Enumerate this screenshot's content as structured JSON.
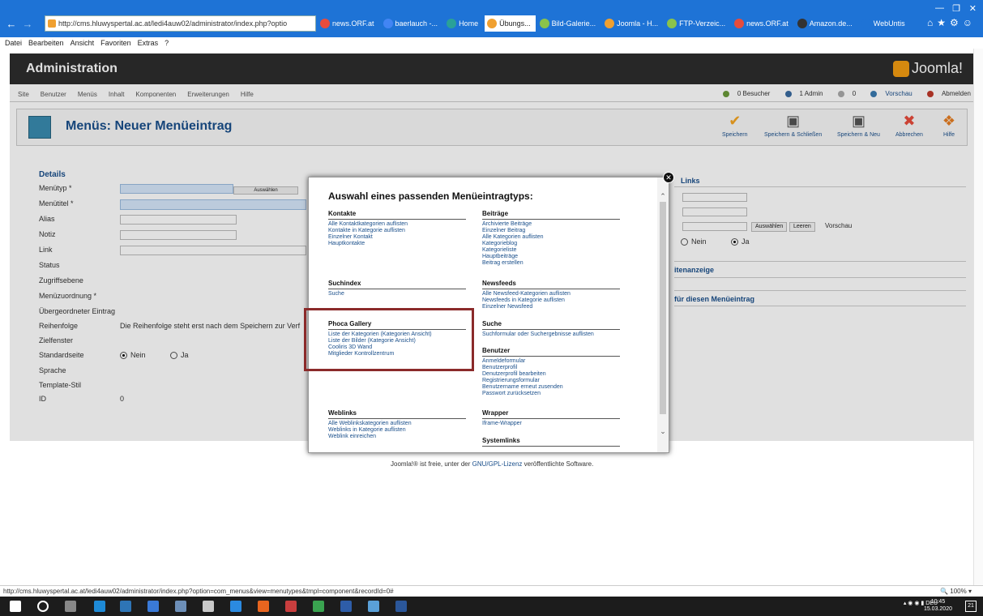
{
  "browser": {
    "url": "http://cms.hluwyspertal.ac.at/ledi4auw02/administrator/index.php?optio",
    "tabs": [
      "news.ORF.at",
      "baerlauch -...",
      "Home",
      "Übungs...",
      "Bild-Galerie...",
      "Joomla - H...",
      "FTP-Verzeic...",
      "news.ORF.at",
      "Amazon.de...",
      "WebUntis"
    ],
    "active_tab_index": 3,
    "menu": [
      "Datei",
      "Bearbeiten",
      "Ansicht",
      "Favoriten",
      "Extras",
      "?"
    ]
  },
  "admin": {
    "title": "Administration",
    "logo": "Joomla!",
    "menu": [
      "Site",
      "Benutzer",
      "Menüs",
      "Inhalt",
      "Komponenten",
      "Erweiterungen",
      "Hilfe"
    ],
    "status": {
      "visitors": "0 Besucher",
      "admins": "1 Admin",
      "messages": "0",
      "preview": "Vorschau",
      "logout": "Abmelden"
    }
  },
  "page_title": "Menüs: Neuer Menüeintrag",
  "toolbar": {
    "save": "Speichern",
    "save_close": "Speichern & Schließen",
    "save_new": "Speichern & Neu",
    "cancel": "Abbrechen",
    "help": "Hilfe"
  },
  "details": {
    "legend": "Details",
    "labels": [
      "Menütyp *",
      "Menütitel *",
      "Alias",
      "Notiz",
      "Link",
      "Status",
      "Zugriffsebene",
      "Menüzuordnung *",
      "Übergeordneter Eintrag",
      "Reihenfolge",
      "Zielfenster",
      "Standardseite",
      "Sprache",
      "Template-Stil",
      "ID"
    ],
    "chooser_button": "Auswählen",
    "ordering_text": "Die Reihenfolge steht erst nach dem Speichern zur Verf",
    "default_no": "Nein",
    "default_yes": "Ja",
    "id_value": "0"
  },
  "right_panel": {
    "links_title": "Links",
    "choose": "Auswählen",
    "clear": "Leeren",
    "preview": "Vorschau",
    "no": "Nein",
    "yes": "Ja",
    "page_display": "itenanzeige",
    "for_item": "für diesen Menüeintrag"
  },
  "footer": {
    "pre": "Joomla!® ist freie, unter der ",
    "link": "GNU/GPL-Lizenz",
    "post": " veröffentlichte Software."
  },
  "modal": {
    "heading": "Auswahl eines passenden Menüeintragtyps:",
    "left_groups": [
      {
        "title": "Kontakte",
        "items": [
          "Alle Kontaktkategorien auflisten",
          "Kontakte in Kategorie auflisten",
          "Einzelner Kontakt",
          "Hauptkontakte"
        ]
      },
      {
        "title": "Suchindex",
        "items": [
          "Suche"
        ]
      },
      {
        "title": "Phoca Gallery",
        "items": [
          "Liste der Kategorien (Kategorien Ansicht)",
          "Liste der Bilder (Kategorie Ansicht)",
          "Cooliris 3D Wand",
          "Mitglieder Kontrollzentrum"
        ]
      },
      {
        "title": "Weblinks",
        "items": [
          "Alle Weblinkskategorien auflisten",
          "Weblinks in Kategorie auflisten",
          "Weblink einreichen"
        ]
      }
    ],
    "right_groups": [
      {
        "title": "Beiträge",
        "items": [
          "Archivierte Beiträge",
          "Einzelner Beitrag",
          "Alle Kategorien auflisten",
          "Kategorieblog",
          "Kategorieliste",
          "Hauptbeiträge",
          "Beitrag erstellen"
        ]
      },
      {
        "title": "Newsfeeds",
        "items": [
          "Alle Newsfeed-Kategorien auflisten",
          "Newsfeeds in Kategorie auflisten",
          "Einzelner Newsfeed"
        ]
      },
      {
        "title": "Suche",
        "items": [
          "Suchformular oder Suchergebnisse auflisten"
        ]
      },
      {
        "title": "Benutzer",
        "items": [
          "Anmeldeformular",
          "Benutzerprofil",
          "Denutzerprofil bearbeiten",
          "Registrierungsformular",
          "Benutzername erneut zusenden",
          "Passwort zurücksetzen"
        ]
      },
      {
        "title": "Wrapper",
        "items": [
          "Iframe-Wrapper"
        ]
      },
      {
        "title": "Systemlinks",
        "items": []
      }
    ]
  },
  "statusbar": {
    "url": "http://cms.hluwyspertal.ac.at/ledi4auw02/administrator/index.php?option=com_menus&view=menutypes&tmpl=component&recordId=0#",
    "zoom": "100%"
  },
  "taskbar": {
    "lang": "DEU",
    "lang2": "DE",
    "time": "10:45",
    "date": "15.03.2020",
    "notifications": "21"
  }
}
